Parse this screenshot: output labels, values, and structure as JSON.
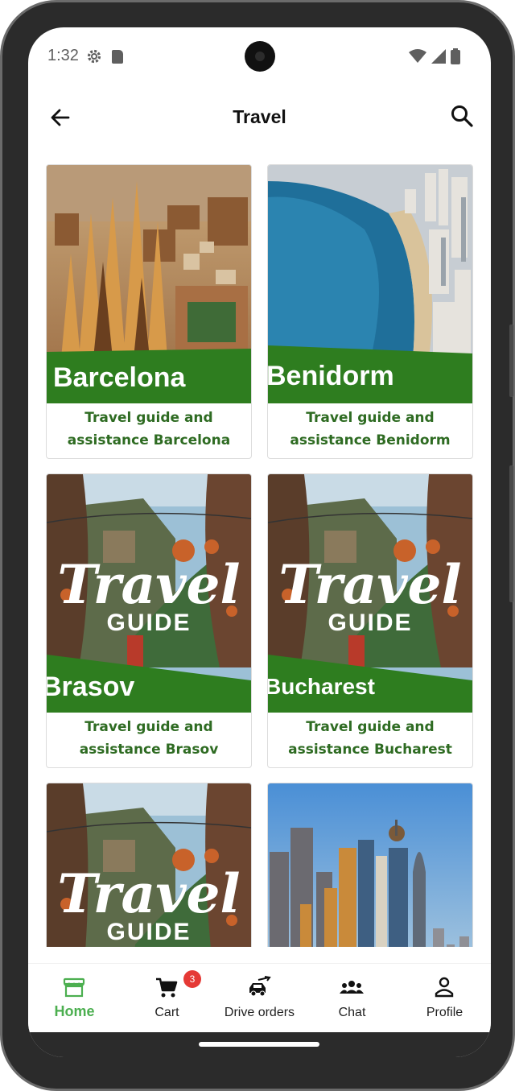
{
  "status_bar": {
    "time": "1:32"
  },
  "app_bar": {
    "title": "Travel"
  },
  "cards": [
    {
      "banner": "Barcelona",
      "caption_line1": "Travel guide and",
      "caption_line2": "assistance Barcelona"
    },
    {
      "banner": "Benidorm",
      "caption_line1": "Travel guide and",
      "caption_line2": "assistance Benidorm"
    },
    {
      "banner": "Brasov",
      "caption_line1": "Travel guide and",
      "caption_line2": "assistance Brasov",
      "poster_line1": "Travel",
      "poster_line2": "GUIDE"
    },
    {
      "banner": "Bucharest",
      "caption_line1": "Travel guide and",
      "caption_line2": "assistance Bucharest",
      "poster_line1": "Travel",
      "poster_line2": "GUIDE"
    },
    {
      "poster_line1": "Travel",
      "poster_line2": "GUIDE"
    },
    {}
  ],
  "bottom_nav": {
    "items": [
      {
        "label": "Home",
        "icon": "store-icon",
        "active": true
      },
      {
        "label": "Cart",
        "icon": "cart-icon",
        "badge": "3"
      },
      {
        "label": "Drive orders",
        "icon": "car-icon"
      },
      {
        "label": "Chat",
        "icon": "group-icon"
      },
      {
        "label": "Profile",
        "icon": "person-icon"
      }
    ]
  },
  "colors": {
    "banner_green": "#2e7d1f",
    "caption_green": "#2e6b22",
    "nav_active": "#4caf50",
    "badge_red": "#e53935"
  }
}
